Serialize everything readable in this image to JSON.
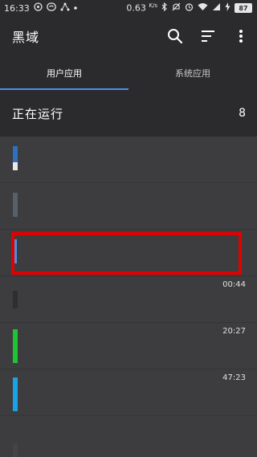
{
  "status_bar": {
    "time": "16:33",
    "speed": "0.63",
    "speed_unit": "K/s",
    "battery": "87"
  },
  "toolbar": {
    "title": "黑域",
    "search_icon": "search-icon",
    "sort_icon": "sort-icon",
    "more_icon": "more-vert-icon"
  },
  "tabs": [
    {
      "label": "用户应用",
      "active": true
    },
    {
      "label": "系统应用",
      "active": false
    }
  ],
  "section": {
    "title": "正在运行",
    "count": "8"
  },
  "list": {
    "rows": [
      {
        "time": "",
        "icon_colors": [
          "#2f6fbf",
          "#e8e8e8"
        ]
      },
      {
        "time": "",
        "icon_colors": [
          "#56606a"
        ]
      },
      {
        "time": "",
        "icon_colors": [
          "#4a90e2"
        ]
      },
      {
        "time": "00:44",
        "icon_colors": [
          "#2e2e2e"
        ]
      },
      {
        "time": "20:27",
        "icon_colors": [
          "#1dc433"
        ]
      },
      {
        "time": "47:23",
        "icon_colors": [
          "#19a2e6"
        ]
      },
      {
        "time": "",
        "icon_colors": [
          "#444444"
        ]
      }
    ]
  },
  "colors": {
    "accent": "#4c8fe6",
    "highlight": "#e20000",
    "background": "#3d3d3f",
    "header": "#2b2b2d"
  }
}
